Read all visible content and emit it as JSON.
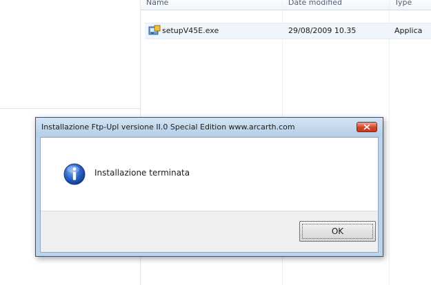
{
  "explorer": {
    "columns": {
      "name": "Name",
      "date": "Date modified",
      "type": "Type"
    },
    "file": {
      "name": "setupV45E.exe",
      "date": "29/08/2009 10.35",
      "type": "Applica",
      "icon": "installer-icon"
    }
  },
  "dialog": {
    "title": "Installazione Ftp-Upl versione II.0 Special Edition www.arcarth.com",
    "message": "Installazione terminata",
    "ok_label": "OK",
    "icon": "info-icon",
    "close_icon": "close-icon"
  },
  "colors": {
    "title_bar": "#bcd3ea",
    "close_button": "#d3442a",
    "info_icon": "#2b62c9",
    "button_bar": "#efefef"
  }
}
